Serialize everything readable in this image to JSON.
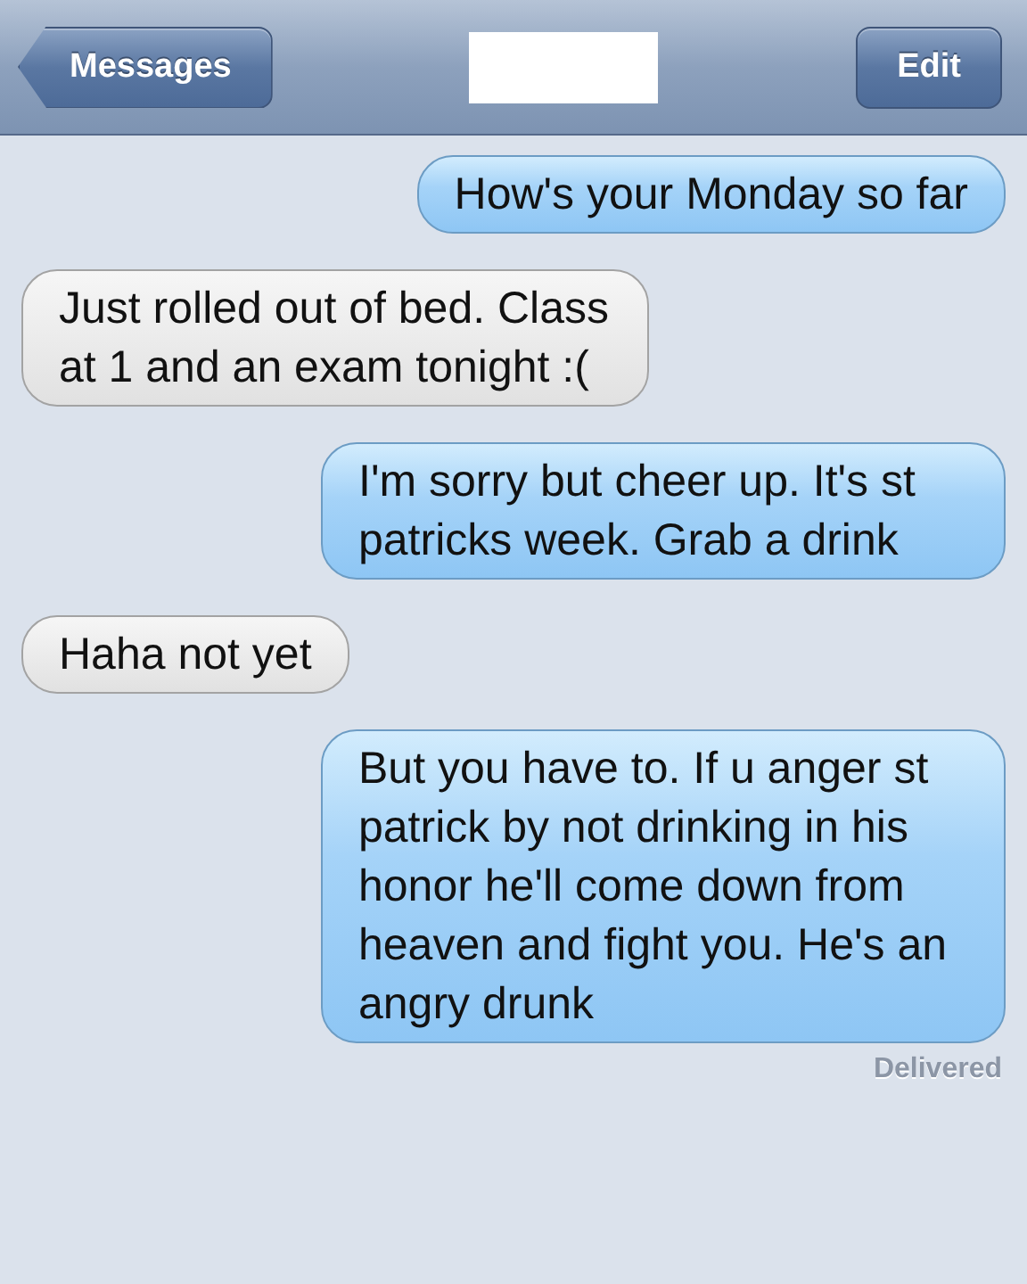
{
  "nav_bar": {
    "back_button": "Messages",
    "edit_button": "Edit"
  },
  "messages": [
    {
      "kind": "sent",
      "text": "How's your Monday so far"
    },
    {
      "kind": "received",
      "text": "Just rolled out of bed. Class at 1 and an exam tonight :("
    },
    {
      "kind": "sent",
      "text": "I'm sorry but cheer up. It's st patricks week. Grab a drink"
    },
    {
      "kind": "received",
      "text": "Haha not yet"
    },
    {
      "kind": "sent",
      "text": "But you have to. If u anger st patrick by not drinking in his honor he'll come down from heaven and fight you. He's an angry drunk"
    }
  ],
  "status": "Delivered"
}
